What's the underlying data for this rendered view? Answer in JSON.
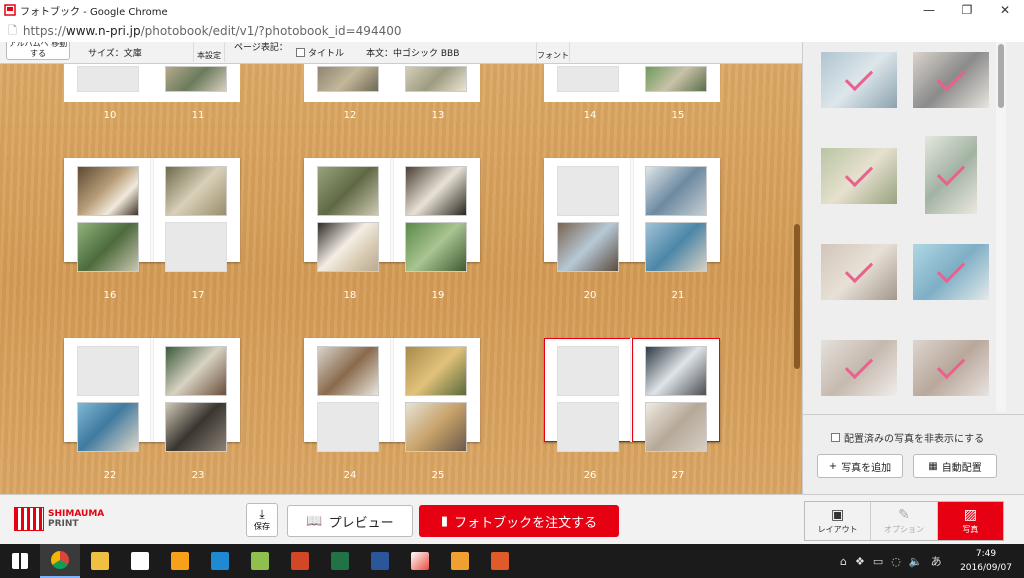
{
  "window": {
    "title": "フォトブック - Google Chrome",
    "minimize": "—",
    "restore": "❐",
    "close": "✕"
  },
  "address": {
    "scheme": "https://",
    "host": "www.n-pri.jp",
    "path": "/photobook/edit/v1/?photobook_id=494400"
  },
  "toolbar": {
    "move_label": "アルバムへ 移動する",
    "size_label": "サイズ：文庫",
    "setting_label": "本設定",
    "page_label": "ページ表記：",
    "title_label": "タイトル",
    "body_font_label": "本文：中ゴシック BBB",
    "font_label": "フォント"
  },
  "spreads_partial": [
    {
      "left": "10",
      "right": "11"
    },
    {
      "left": "12",
      "right": "13"
    },
    {
      "left": "14",
      "right": "15"
    }
  ],
  "spreads": [
    {
      "left": "16",
      "right": "17"
    },
    {
      "left": "18",
      "right": "19"
    },
    {
      "left": "20",
      "right": "21"
    },
    {
      "left": "22",
      "right": "23"
    },
    {
      "left": "24",
      "right": "25"
    },
    {
      "left": "26",
      "right": "27"
    }
  ],
  "panel": {
    "hide_placed_label": "配置済みの写真を非表示にする",
    "add_photo_label": "写真を追加",
    "auto_place_label": "自動配置"
  },
  "bottom": {
    "brand_line1": "SHIMAUMA",
    "brand_line2": "PRINT",
    "save_label": "保存",
    "preview_label": "プレビュー",
    "order_label": "フォトブックを注文する",
    "tab_layout": "レイアウト",
    "tab_option": "オプション",
    "tab_photo": "写真"
  },
  "taskbar": {
    "time": "7:49",
    "date": "2016/09/07",
    "ime": "あ"
  },
  "colors": {
    "accent": "#e60012",
    "check": "#e8336d",
    "wood": "#d9a25d"
  }
}
